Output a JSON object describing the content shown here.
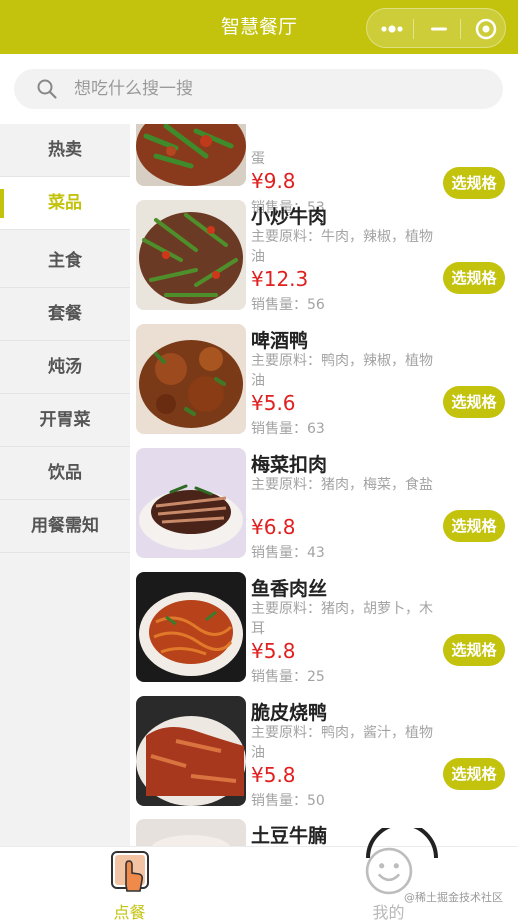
{
  "navbar": {
    "title": "智慧餐厅"
  },
  "search": {
    "placeholder": "想吃什么搜一搜"
  },
  "sidebar": {
    "items": [
      {
        "label": "热卖",
        "active": false
      },
      {
        "label": "菜品",
        "active": true
      },
      {
        "label": "主食",
        "active": false
      },
      {
        "label": "套餐",
        "active": false
      },
      {
        "label": "炖汤",
        "active": false
      },
      {
        "label": "开胃菜",
        "active": false
      },
      {
        "label": "饮品",
        "active": false
      },
      {
        "label": "用餐需知",
        "active": false
      }
    ]
  },
  "dishes": [
    {
      "name": "",
      "desc": "蛋",
      "price": "¥9.8",
      "sales": "销售量：53",
      "button": "选规格"
    },
    {
      "name": "小炒牛肉",
      "desc": "主要原料：牛肉，辣椒，植物油",
      "price": "¥12.3",
      "sales": "销售量：56",
      "button": "选规格"
    },
    {
      "name": "啤酒鸭",
      "desc": "主要原料：鸭肉，辣椒，植物油",
      "price": "¥5.6",
      "sales": "销售量：63",
      "button": "选规格"
    },
    {
      "name": "梅菜扣肉",
      "desc": "主要原料：猪肉，梅菜，食盐",
      "price": "¥6.8",
      "sales": "销售量：43",
      "button": "选规格"
    },
    {
      "name": "鱼香肉丝",
      "desc": "主要原料：猪肉，胡萝卜，木耳",
      "price": "¥5.8",
      "sales": "销售量：25",
      "button": "选规格"
    },
    {
      "name": "脆皮烧鸭",
      "desc": "主要原料：鸭肉，酱汁，植物油",
      "price": "¥5.8",
      "sales": "销售量：50",
      "button": "选规格"
    },
    {
      "name": "土豆牛腩",
      "desc": "",
      "price": "",
      "sales": "",
      "button": ""
    }
  ],
  "tabbar": {
    "order_label": "点餐",
    "mine_label": "我的"
  },
  "watermark": "@稀土掘金技术社区",
  "colors": {
    "accent": "#c3c30e",
    "price": "#e02020",
    "muted": "#a3a3a3"
  }
}
